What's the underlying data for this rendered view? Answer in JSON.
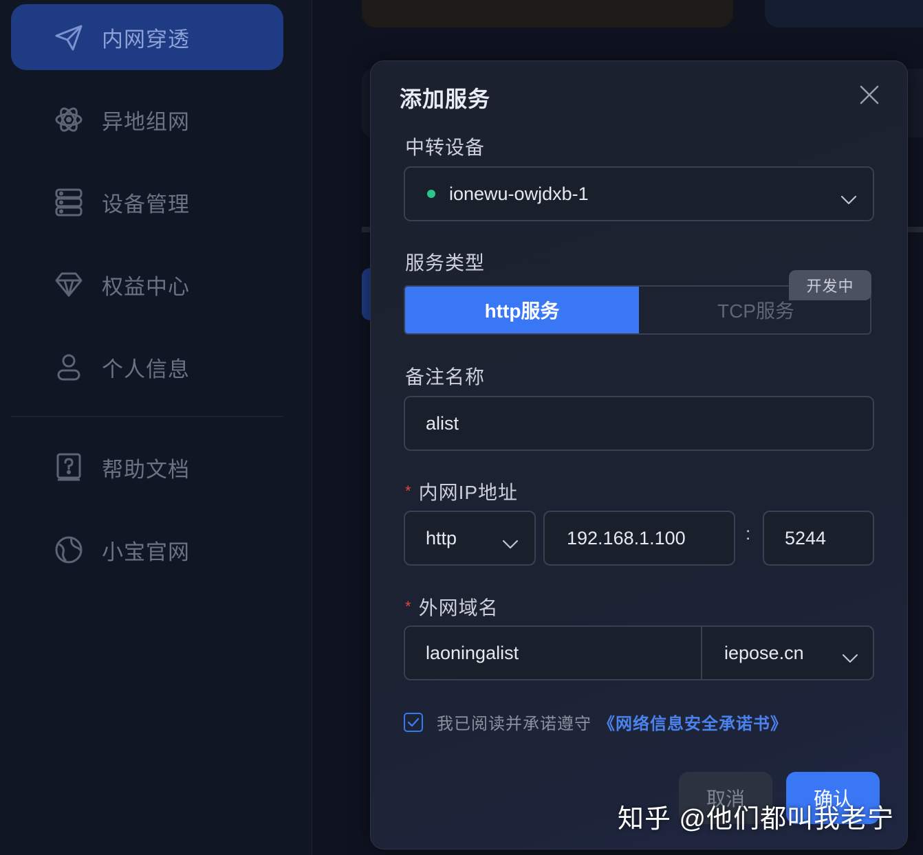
{
  "sidebar": {
    "items": [
      {
        "label": "内网穿透",
        "icon": "paper-plane-icon",
        "active": true
      },
      {
        "label": "异地组网",
        "icon": "atom-icon",
        "active": false
      },
      {
        "label": "设备管理",
        "icon": "server-icon",
        "active": false
      },
      {
        "label": "权益中心",
        "icon": "diamond-icon",
        "active": false
      },
      {
        "label": "个人信息",
        "icon": "user-icon",
        "active": false
      }
    ],
    "secondary_items": [
      {
        "label": "帮助文档",
        "icon": "help-book-icon"
      },
      {
        "label": "小宝官网",
        "icon": "globe-icon"
      }
    ]
  },
  "modal": {
    "title": "添加服务",
    "relay_device": {
      "label": "中转设备",
      "value": "ionewu-owjdxb-1",
      "status_color": "#2bc48a"
    },
    "service_type": {
      "label": "服务类型",
      "options": [
        "http服务",
        "TCP服务"
      ],
      "selected": "http服务",
      "badge": "开发中"
    },
    "remark": {
      "label": "备注名称",
      "value": "alist"
    },
    "lan_ip": {
      "label": "内网IP地址",
      "required_mark": "*",
      "protocol": "http",
      "ip": "192.168.1.100",
      "separator": ":",
      "port": "5244"
    },
    "domain": {
      "label": "外网域名",
      "required_mark": "*",
      "subdomain": "laoningalist",
      "suffix": "iepose.cn"
    },
    "agreement": {
      "text": "我已阅读并承诺遵守",
      "link": "《网络信息安全承诺书》",
      "checked": true
    },
    "buttons": {
      "cancel": "取消",
      "confirm": "确认"
    }
  },
  "watermark": "知乎 @他们都叫我老宁",
  "colors": {
    "accent": "#3a77f5",
    "active_nav": "#1e3b84",
    "required": "#e0453f",
    "status_online": "#2bc48a"
  }
}
